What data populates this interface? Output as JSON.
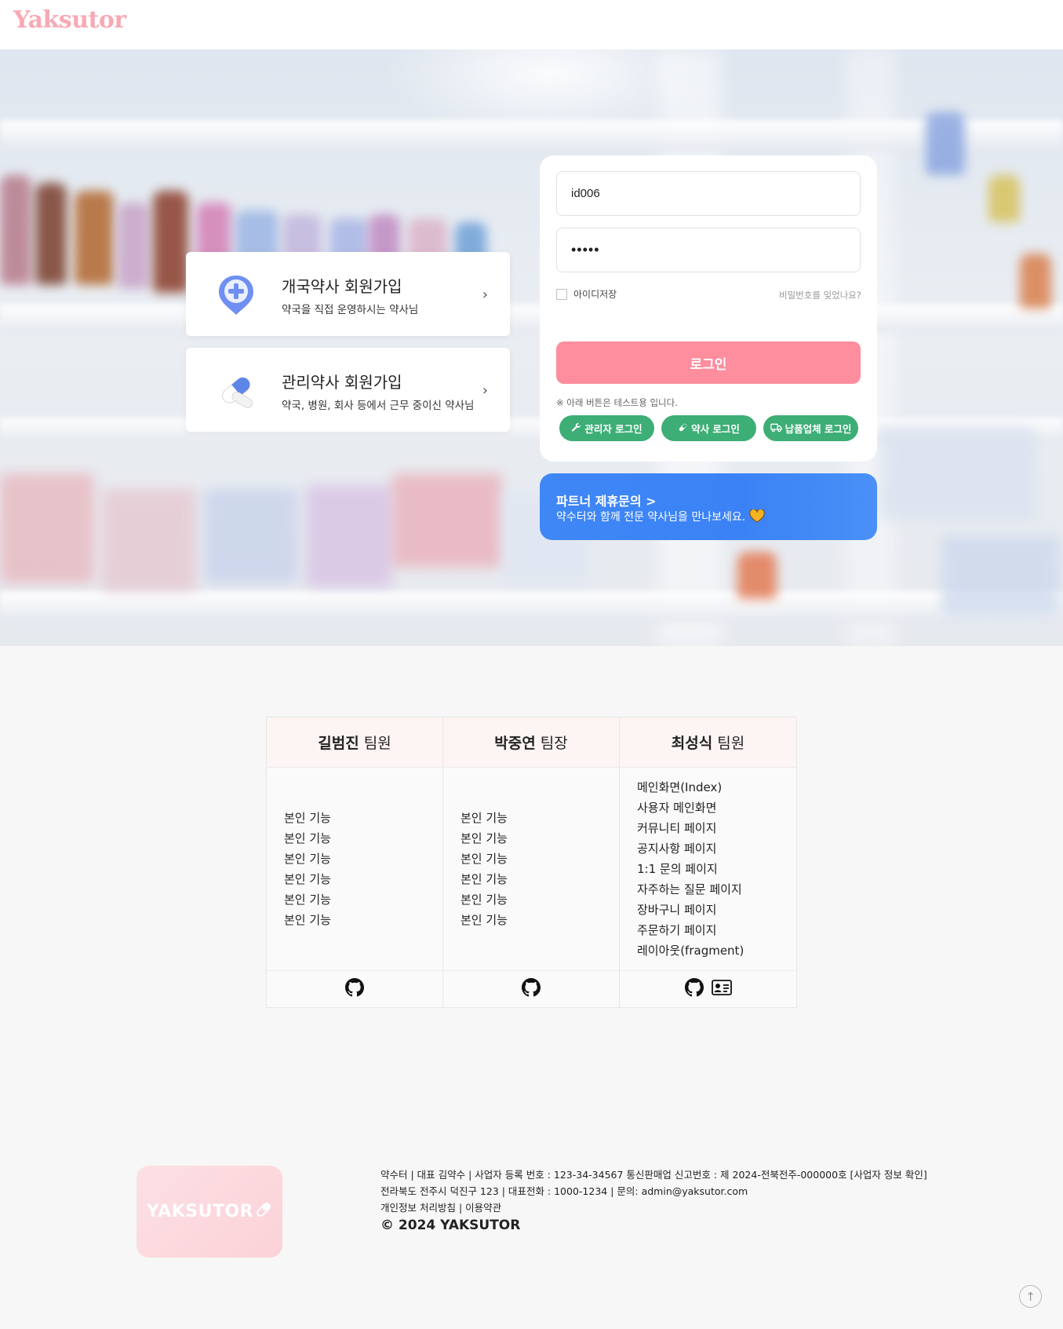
{
  "header": {
    "logo": "Yaksutor"
  },
  "signup": [
    {
      "title": "개국약사 회원가입",
      "subtitle": "약국을 직접 운영하시는 약사님",
      "icon": "pharmacy-plus-pin-icon"
    },
    {
      "title": "관리약사 회원가입",
      "subtitle": "약국, 병원, 회사 등에서 근무 중이신 약사님",
      "icon": "capsule-icon"
    }
  ],
  "login": {
    "id_value": "id006",
    "password_value": "•••••",
    "remember_label": "아이디저장",
    "forgot_label": "비밀번호를 잊었나요?",
    "submit_label": "로그인",
    "test_note": "※ 아래 버튼은 테스트용 입니다.",
    "test_buttons": [
      {
        "label": "관리자 로그인",
        "icon": "wrench-icon"
      },
      {
        "label": "약사 로그인",
        "icon": "pill-icon"
      },
      {
        "label": "납품업체 로그인",
        "icon": "truck-icon"
      }
    ]
  },
  "partner": {
    "title": "파트너 제휴문의 >",
    "subtitle": "약수터와 함께 전문 약사님을 만나보세요."
  },
  "team": [
    {
      "name": "길범진",
      "role": "팀원",
      "items": [
        "본인 기능",
        "본인 기능",
        "본인 기능",
        "본인 기능",
        "본인 기능",
        "본인 기능"
      ],
      "links": [
        "github-icon"
      ]
    },
    {
      "name": "박중연",
      "role": "팀장",
      "items": [
        "본인 기능",
        "본인 기능",
        "본인 기능",
        "본인 기능",
        "본인 기능",
        "본인 기능"
      ],
      "links": [
        "github-icon"
      ]
    },
    {
      "name": "최성식",
      "role": "팀원",
      "items": [
        "메인화면(Index)",
        "사용자 메인화면",
        "커뮤니티 페이지",
        "공지사항 페이지",
        "1:1 문의 페이지",
        "자주하는 질문 페이지",
        "장바구니 페이지",
        "주문하기 페이지",
        "레이아웃(fragment)"
      ],
      "links": [
        "github-icon",
        "id-card-icon"
      ]
    }
  ],
  "footer": {
    "logo": "YAKSUTOR",
    "line1": "약수터 | 대표 김약수 | 사업자 등록 번호 : 123-34-34567 통신판매업 신고번호 : 제 2024-전북전주-000000호 [사업자 정보 확인]",
    "line2": "전라북도 전주시 덕진구 123 | 대표전화 : 1000-1234 | 문의: admin@yaksutor.com",
    "line3": "개인정보 처리방침 | 이용약관",
    "copyright": "© 2024 YAKSUTOR"
  },
  "colors": {
    "brand_pink": "#f8a9b4",
    "login_button": "#fe8d9d",
    "test_button": "#3dae76",
    "partner_blue": "#3b82f6"
  }
}
